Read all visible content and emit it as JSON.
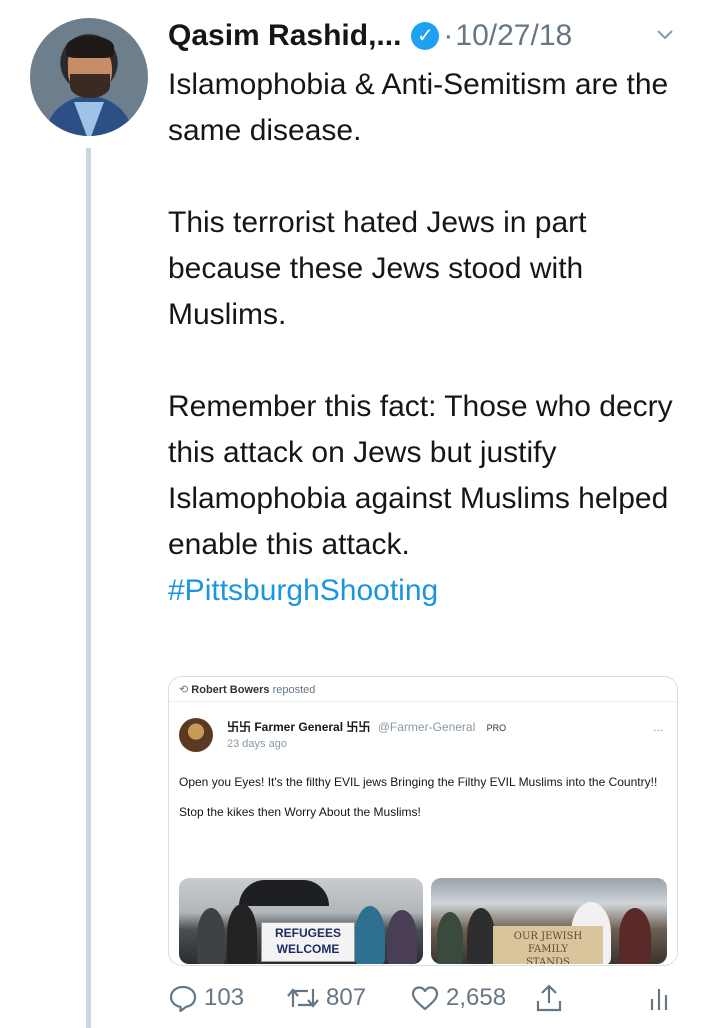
{
  "tweet": {
    "author_name": "Qasim Rashid,...",
    "verified_glyph": "✓",
    "separator": "·",
    "date": "10/27/18",
    "paragraphs": [
      "Islamophobia & Anti-Semitism are the same disease.",
      "This terrorist hated Jews in part because these Jews stood with Muslims.",
      "Remember this fact: Those who decry this attack on Jews but justify Islamophobia against Muslims helped enable this attack."
    ],
    "hashtag": "#PittsburghShooting",
    "icons": [
      "avatar",
      "verified-badge-icon",
      "chevron-down-icon",
      "reply-icon",
      "retweet-icon",
      "like-icon",
      "share-icon",
      "analytics-icon"
    ]
  },
  "embedded": {
    "reposted_by": "Robert Bowers",
    "reposted_label": "reposted",
    "author": "卐卐 Farmer General 卐卐",
    "handle": "@Farmer-General",
    "badge": "PRO",
    "time": "23 days ago",
    "more": "...",
    "text_1": "Open you Eyes!  It's the filthy EVIL jews Bringing the Filthy EVIL Muslims into the Country!!",
    "text_2": "Stop the kikes then Worry About the Muslims!",
    "photo_1_sign_line1": "REFUGEES",
    "photo_1_sign_line2": "WELCOME",
    "photo_2_sign_line1": "OUR JEWISH FAMILY",
    "photo_2_sign_line2": "STANDS"
  },
  "actions": {
    "replies": "103",
    "retweets": "807",
    "likes": "2,658"
  },
  "colors": {
    "link": "#1b95e0",
    "muted": "#657786",
    "verified": "#1da1f2",
    "thread_line": "#ccd6dd"
  }
}
